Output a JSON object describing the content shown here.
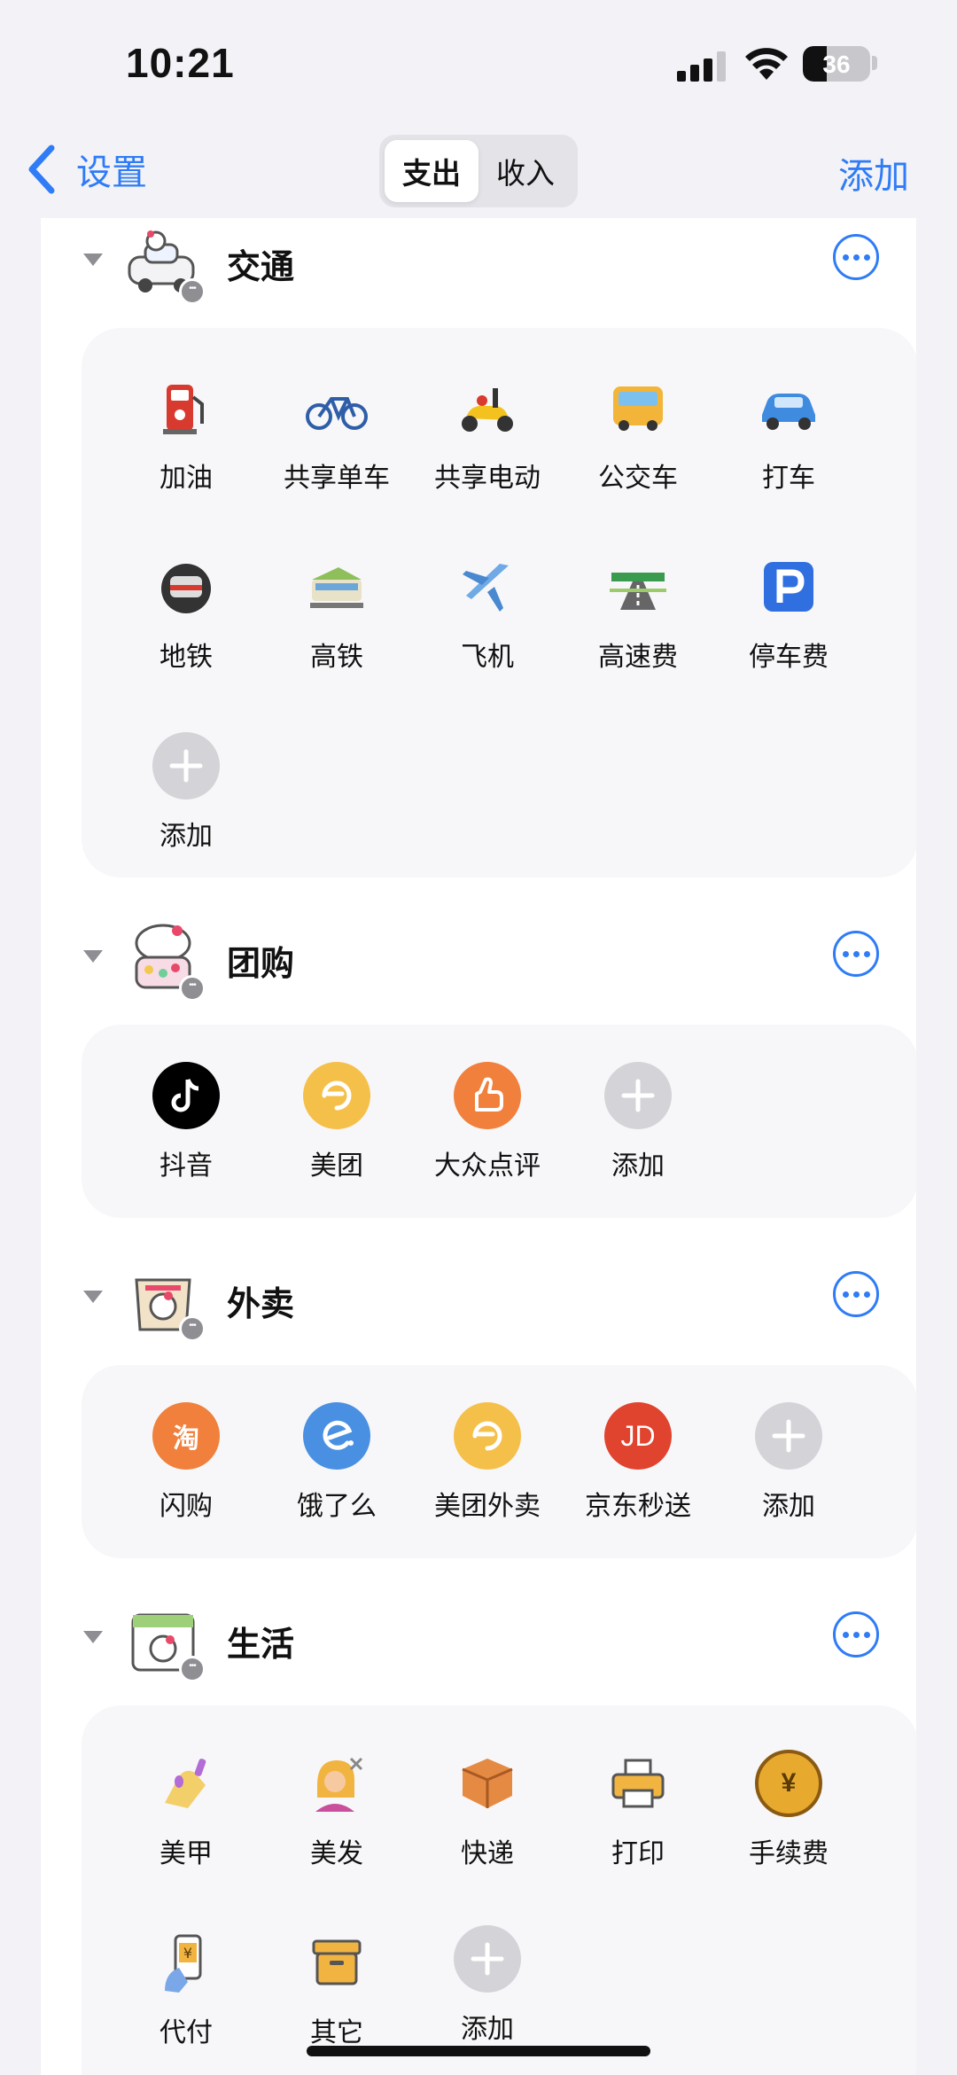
{
  "status_bar": {
    "time": "10:21",
    "battery": "36",
    "battery_fraction": 0.36
  },
  "nav": {
    "back_label": "设置",
    "tabs": [
      "支出",
      "收入"
    ],
    "active_tab": "支出",
    "add_label": "添加"
  },
  "categories": [
    {
      "title": "交通",
      "items": [
        {
          "label": "加油",
          "icon": "fuel-pump-icon"
        },
        {
          "label": "共享单车",
          "icon": "bicycle-icon"
        },
        {
          "label": "共享电动",
          "icon": "scooter-icon"
        },
        {
          "label": "公交车",
          "icon": "bus-icon"
        },
        {
          "label": "打车",
          "icon": "car-icon"
        },
        {
          "label": "地铁",
          "icon": "metro-icon"
        },
        {
          "label": "高铁",
          "icon": "train-icon"
        },
        {
          "label": "飞机",
          "icon": "airplane-icon"
        },
        {
          "label": "高速费",
          "icon": "highway-icon"
        },
        {
          "label": "停车费",
          "icon": "parking-icon"
        },
        {
          "label": "添加",
          "icon": "plus-icon"
        }
      ]
    },
    {
      "title": "团购",
      "items": [
        {
          "label": "抖音",
          "icon": "douyin-icon"
        },
        {
          "label": "美团",
          "icon": "meituan-icon"
        },
        {
          "label": "大众点评",
          "icon": "dianping-icon"
        },
        {
          "label": "添加",
          "icon": "plus-icon"
        }
      ]
    },
    {
      "title": "外卖",
      "items": [
        {
          "label": "闪购",
          "icon": "taobao-icon",
          "glyph": "淘"
        },
        {
          "label": "饿了么",
          "icon": "eleme-icon"
        },
        {
          "label": "美团外卖",
          "icon": "meituan-icon"
        },
        {
          "label": "京东秒送",
          "icon": "jd-icon",
          "glyph": "JD"
        },
        {
          "label": "添加",
          "icon": "plus-icon"
        }
      ]
    },
    {
      "title": "生活",
      "items": [
        {
          "label": "美甲",
          "icon": "nail-polish-icon"
        },
        {
          "label": "美发",
          "icon": "haircut-icon"
        },
        {
          "label": "快递",
          "icon": "package-icon"
        },
        {
          "label": "打印",
          "icon": "printer-icon"
        },
        {
          "label": "手续费",
          "icon": "yen-coin-icon",
          "glyph": "¥"
        },
        {
          "label": "代付",
          "icon": "phone-pay-icon",
          "glyph": "¥"
        },
        {
          "label": "其它",
          "icon": "box-icon"
        },
        {
          "label": "添加",
          "icon": "plus-icon"
        }
      ]
    }
  ],
  "colors": {
    "accent": "#2f7cf6",
    "douyin": "#000000",
    "meituan": "#f5c04a",
    "dianping": "#f0803c",
    "taobao": "#f0803c",
    "eleme": "#4a90e2",
    "jd": "#e0432e",
    "plus": "#d4d4d8"
  }
}
